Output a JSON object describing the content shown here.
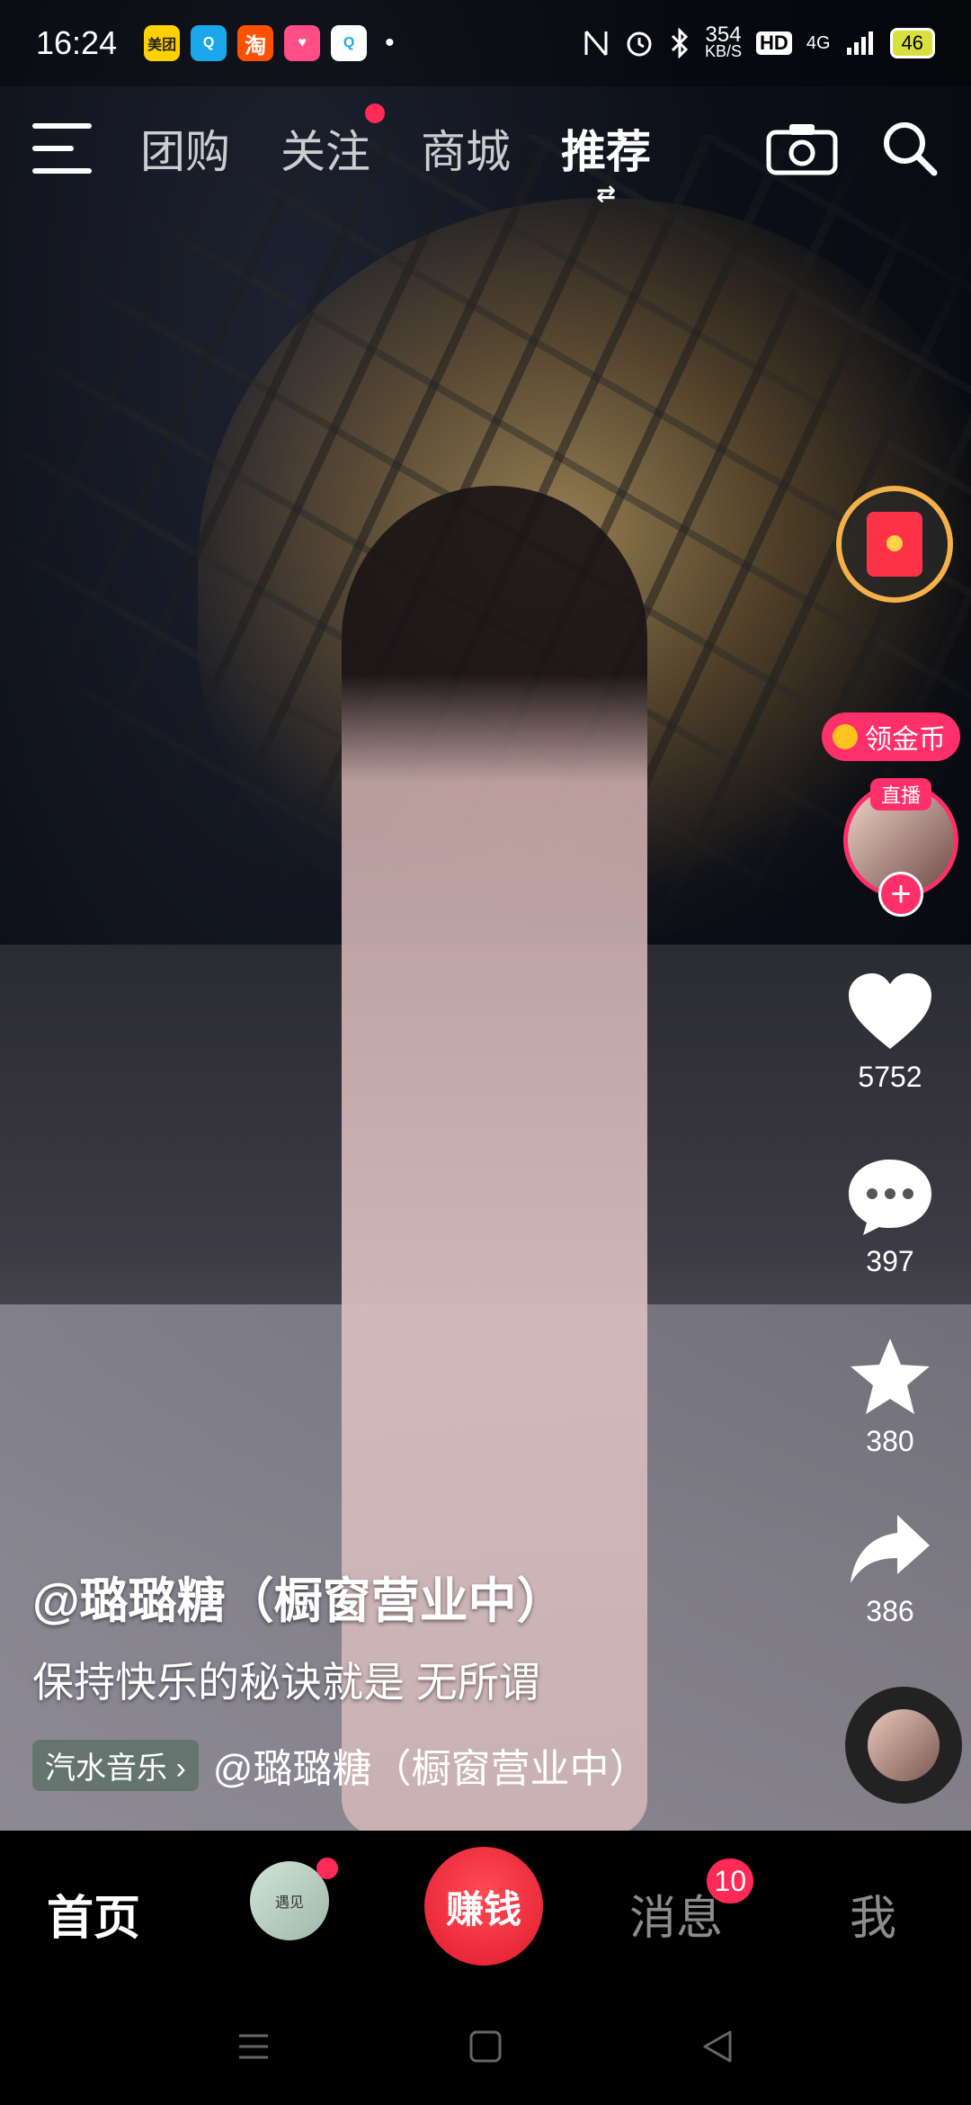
{
  "status_bar": {
    "time": "16:24",
    "apps": [
      {
        "name": "美团",
        "color": "#ffd100"
      },
      {
        "name": "Q",
        "color": "#1aa7ec"
      },
      {
        "name": "淘",
        "color": "#ff5000"
      },
      {
        "name": "♥",
        "color": "#ff4d88"
      },
      {
        "name": "Q",
        "color": "#ffffff"
      }
    ],
    "dot": "•",
    "net_speed_value": "354",
    "net_speed_unit": "KB/S",
    "hd": "HD",
    "signal": "4G",
    "battery": "46"
  },
  "top_nav": {
    "tabs": [
      {
        "label": "团购"
      },
      {
        "label": "关注"
      },
      {
        "label": "商城"
      },
      {
        "label": "推荐"
      }
    ],
    "active_tab": "推荐",
    "switch_glyph": "⇄"
  },
  "right_rail": {
    "coin_label": "领金币",
    "live_label": "直播",
    "follow_glyph": "+",
    "likes": "5752",
    "comments": "397",
    "favorites": "380",
    "shares": "386"
  },
  "caption": {
    "author": "@璐璐糖（橱窗营业中）",
    "description": "保持快乐的秘诀就是 无所谓",
    "music_tag": "汽水音乐 ›",
    "music_text": "@璐璐糖（橱窗营业中）"
  },
  "bottom_nav": {
    "home": "首页",
    "friend_text": "遇见",
    "earn": "赚钱",
    "messages": "消息",
    "messages_badge": "10",
    "me": "我"
  },
  "colors": {
    "accent": "#ff2f6a",
    "earn_button": "#e21b2c",
    "coin": "#ffc31f"
  }
}
